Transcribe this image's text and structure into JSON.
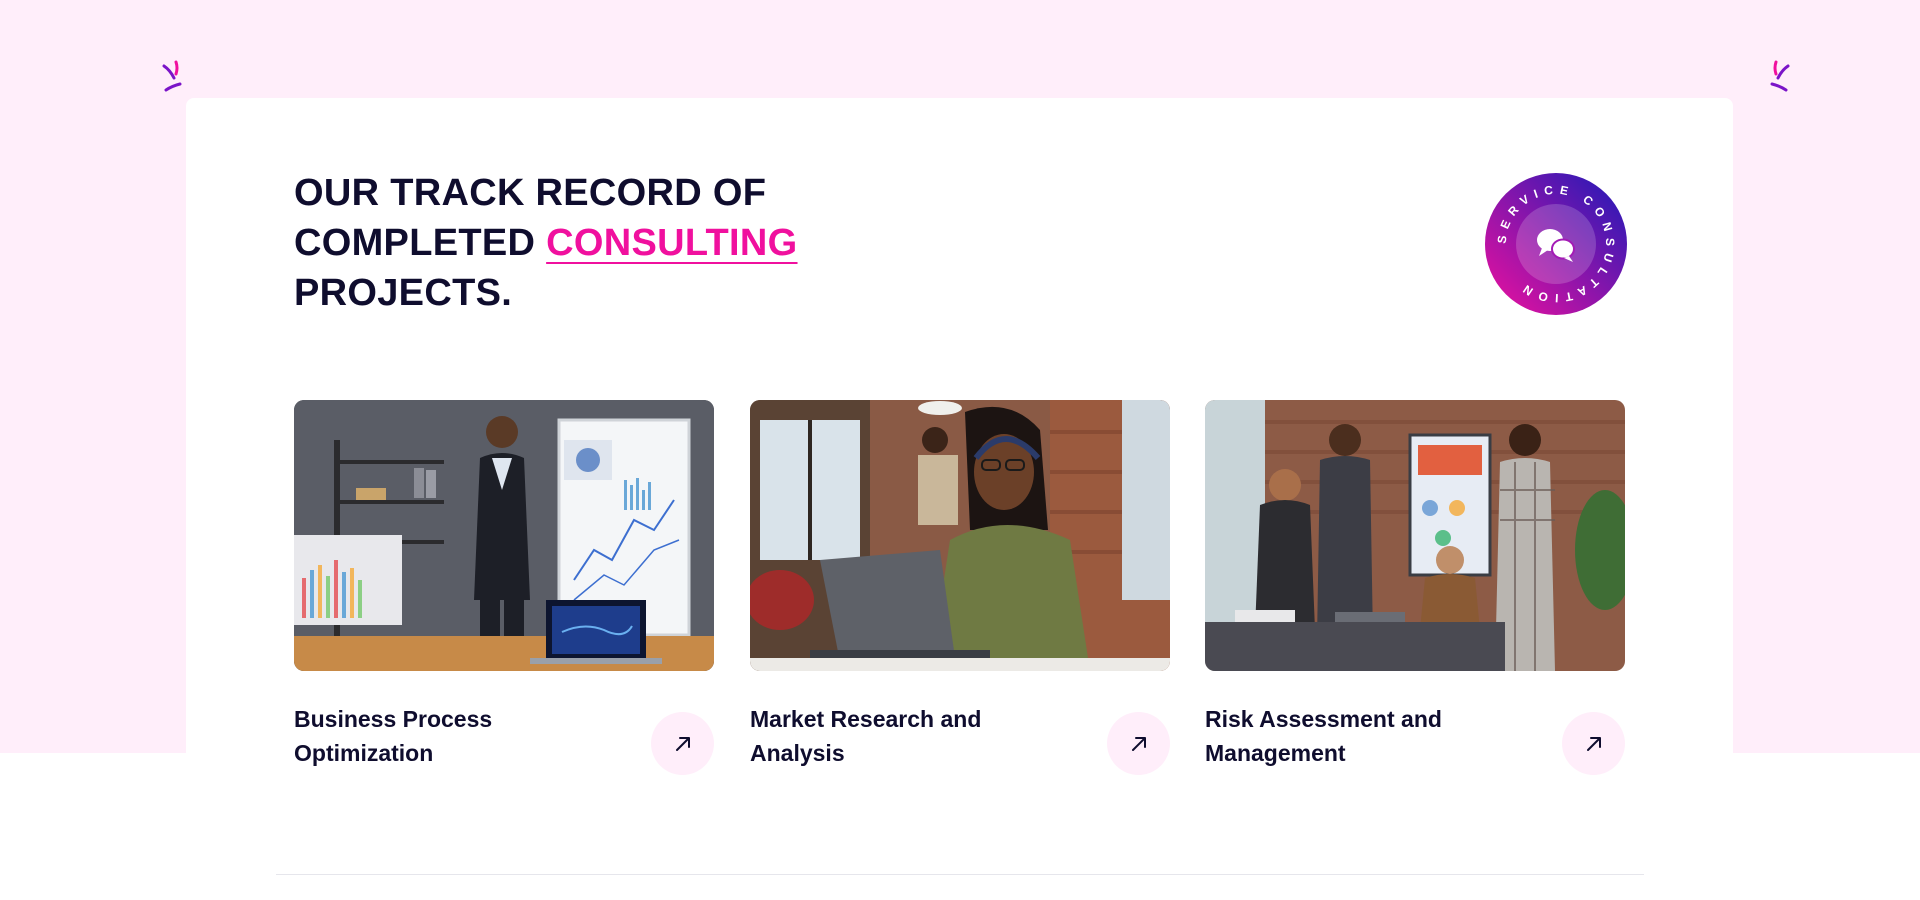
{
  "section": {
    "title_part1": "OUR TRACK RECORD OF",
    "title_part2": "COMPLETED ",
    "title_accent": "CONSULTING ",
    "title_part3": "PROJECTS.",
    "accent_color": "#f0109e",
    "heading_color": "#0f0d2e",
    "background_color": "#ffeefa"
  },
  "badge": {
    "ring_text": "SERVICE CONSULTATION",
    "icon": "chat-bubbles-icon",
    "gradient_start": "#f0109e",
    "gradient_end": "#1b1ab8"
  },
  "projects": [
    {
      "title_line1": "Business Process",
      "title_line2": "Optimization",
      "image": "consultant-at-whiteboard-photo",
      "link_icon": "arrow-up-right-icon"
    },
    {
      "title_line1": "Market Research and",
      "title_line2": "Analysis",
      "image": "woman-with-headset-laptop-photo",
      "link_icon": "arrow-up-right-icon"
    },
    {
      "title_line1": "Risk Assessment and",
      "title_line2": "Management",
      "image": "team-meeting-office-photo",
      "link_icon": "arrow-up-right-icon"
    }
  ]
}
